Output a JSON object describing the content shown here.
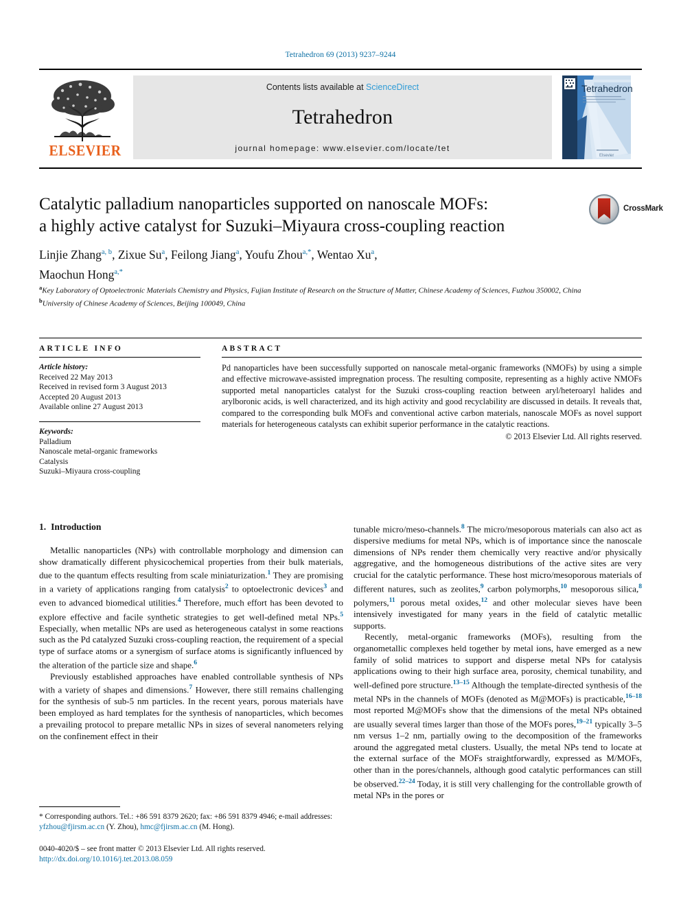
{
  "running_head": "Tetrahedron 69 (2013) 9237–9244",
  "masthead": {
    "publisher_name": "ELSEVIER",
    "contents_prefix": "Contents lists available at ",
    "contents_link": "ScienceDirect",
    "journal_name": "Tetrahedron",
    "homepage": "journal homepage: www.elsevier.com/locate/tet",
    "cover_title": "Tetrahedron",
    "cover_footer": "Elsevier"
  },
  "article": {
    "title_line1": "Catalytic palladium nanoparticles supported on nanoscale MOFs:",
    "title_line2": "a highly active catalyst for Suzuki–Miyaura cross-coupling reaction",
    "crossmark_label": "CrossMark",
    "authors_line1": "Linjie Zhang",
    "authors": [
      {
        "name": "Linjie Zhang",
        "sup": "a, b"
      },
      {
        "name": "Zixue Su",
        "sup": "a"
      },
      {
        "name": "Feilong Jiang",
        "sup": "a"
      },
      {
        "name": "Youfu Zhou",
        "sup": "a,*"
      },
      {
        "name": "Wentao Xu",
        "sup": "a"
      },
      {
        "name": "Maochun Hong",
        "sup": "a,*"
      }
    ],
    "affiliations": [
      {
        "sup": "a",
        "text": "Key Laboratory of Optoelectronic Materials Chemistry and Physics, Fujian Institute of Research on the Structure of Matter, Chinese Academy of Sciences, Fuzhou 350002, China"
      },
      {
        "sup": "b",
        "text": "University of Chinese Academy of Sciences, Beijing 100049, China"
      }
    ]
  },
  "article_info": {
    "heading": "ARTICLE INFO",
    "history_label": "Article history:",
    "history": [
      "Received 22 May 2013",
      "Received in revised form 3 August 2013",
      "Accepted 20 August 2013",
      "Available online 27 August 2013"
    ],
    "keywords_label": "Keywords:",
    "keywords": [
      "Palladium",
      "Nanoscale metal-organic frameworks",
      "Catalysis",
      "Suzuki–Miyaura cross-coupling"
    ]
  },
  "abstract": {
    "heading": "ABSTRACT",
    "text": "Pd nanoparticles have been successfully supported on nanoscale metal-organic frameworks (NMOFs) by using a simple and effective microwave-assisted impregnation process. The resulting composite, representing as a highly active NMOFs supported metal nanoparticles catalyst for the Suzuki cross-coupling reaction between aryl/heteroaryl halides and arylboronic acids, is well characterized, and its high activity and good recyclability are discussed in details. It reveals that, compared to the corresponding bulk MOFs and conventional active carbon materials, nanoscale MOFs as novel support materials for heterogeneous catalysts can exhibit superior performance in the catalytic reactions.",
    "copyright": "© 2013 Elsevier Ltd. All rights reserved."
  },
  "body": {
    "section_number": "1.",
    "section_title": "Introduction",
    "left_paragraphs": [
      {
        "runs": [
          {
            "t": "Metallic nanoparticles (NPs) with controllable morphology and dimension can show dramatically different physicochemical properties from their bulk materials, due to the quantum effects resulting from scale miniaturization."
          },
          {
            "t": "1",
            "ref": true
          },
          {
            "t": " They are promising in a variety of applications ranging from catalysis"
          },
          {
            "t": "2",
            "ref": true
          },
          {
            "t": " to optoelectronic devices"
          },
          {
            "t": "3",
            "ref": true
          },
          {
            "t": " and even to advanced biomedical utilities."
          },
          {
            "t": "4",
            "ref": true
          },
          {
            "t": " Therefore, much effort has been devoted to explore effective and facile synthetic strategies to get well-defined metal NPs."
          },
          {
            "t": "5",
            "ref": true
          },
          {
            "t": " Especially, when metallic NPs are used as heterogeneous catalyst in some reactions such as the Pd catalyzed Suzuki cross-coupling reaction, the requirement of a special type of surface atoms or a synergism of surface atoms is significantly influenced by the alteration of the particle size and shape."
          },
          {
            "t": "6",
            "ref": true
          }
        ]
      },
      {
        "runs": [
          {
            "t": "Previously established approaches have enabled controllable synthesis of NPs with a variety of shapes and dimensions."
          },
          {
            "t": "7",
            "ref": true
          },
          {
            "t": " However, there still remains challenging for the synthesis of sub-5 nm particles. In the recent years, porous materials have been employed as hard templates for the synthesis of nanoparticles, which becomes a prevailing protocol to prepare metallic NPs in sizes of several nanometers relying on the confinement effect in their"
          }
        ]
      }
    ],
    "right_paragraphs": [
      {
        "runs": [
          {
            "t": "tunable micro/meso-channels."
          },
          {
            "t": "8",
            "ref": true
          },
          {
            "t": " The micro/mesoporous materials can also act as dispersive mediums for metal NPs, which is of importance since the nanoscale dimensions of NPs render them chemically very reactive and/or physically aggregative, and the homogeneous distributions of the active sites are very crucial for the catalytic performance. These host micro/mesoporous materials of different natures, such as zeolites,"
          },
          {
            "t": "9",
            "ref": true
          },
          {
            "t": " carbon polymorphs,"
          },
          {
            "t": "10",
            "ref": true
          },
          {
            "t": " mesoporous silica,"
          },
          {
            "t": "8",
            "ref": true
          },
          {
            "t": " polymers,"
          },
          {
            "t": "11",
            "ref": true
          },
          {
            "t": " porous metal oxides,"
          },
          {
            "t": "12",
            "ref": true
          },
          {
            "t": " and other molecular sieves have been intensively investigated for many years in the field of catalytic metallic supports."
          }
        ],
        "no_indent": true
      },
      {
        "runs": [
          {
            "t": "Recently, metal-organic frameworks (MOFs), resulting from the organometallic complexes held together by metal ions, have emerged as a new family of solid matrices to support and disperse metal NPs for catalysis applications owing to their high surface area, porosity, chemical tunability, and well-defined pore structure."
          },
          {
            "t": "13–15",
            "ref": true
          },
          {
            "t": " Although the template-directed synthesis of the metal NPs in the channels of MOFs (denoted as M@MOFs) is practicable,"
          },
          {
            "t": "16–18",
            "ref": true
          },
          {
            "t": " most reported M@MOFs show that the dimensions of the metal NPs obtained are usually several times larger than those of the MOFs pores,"
          },
          {
            "t": "19–21",
            "ref": true
          },
          {
            "t": " typically 3–5 nm versus 1–2 nm, partially owing to the decomposition of the frameworks around the aggregated metal clusters. Usually, the metal NPs tend to locate at the external surface of the MOFs straightforwardly, expressed as M/MOFs, other than in the pores/channels, although good catalytic performances can still be observed."
          },
          {
            "t": "22–24",
            "ref": true
          },
          {
            "t": " Today, it is still very challenging for the controllable growth of metal NPs in the pores or"
          }
        ]
      }
    ]
  },
  "footnote": {
    "marker": "*",
    "corresponding": "Corresponding authors. Tel.: +86 591 8379 2620; fax: +86 591 8379 4946;",
    "email_label": "e-mail addresses:",
    "email1": "yfzhou@fjirsm.ac.cn",
    "email1_owner": "(Y. Zhou),",
    "email2": "hmc@fjirsm.ac.cn",
    "email2_owner": "(M. Hong)."
  },
  "page_footer": {
    "issn_line": "0040-4020/$ – see front matter © 2013 Elsevier Ltd. All rights reserved.",
    "doi": "http://dx.doi.org/10.1016/j.tet.2013.08.059"
  },
  "colors": {
    "link_blue": "#0b6fa4",
    "sciencedirect_blue": "#2e9bd6",
    "elsevier_orange": "#e8601c"
  }
}
